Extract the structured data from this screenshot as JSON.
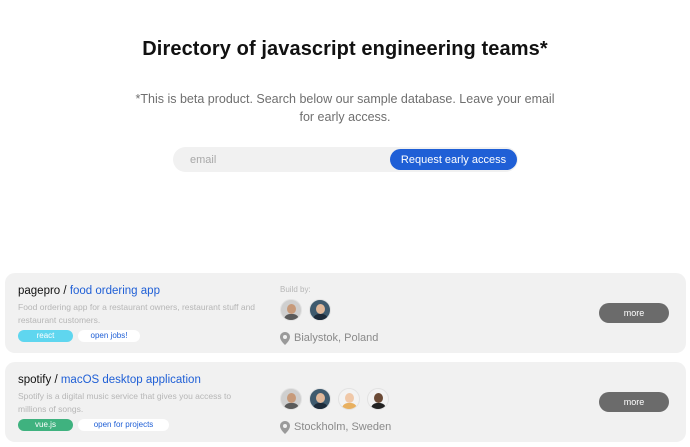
{
  "hero": {
    "title": "Directory of  javascript engineering teams*",
    "subtitle": "*This is beta product. Search below our sample database. Leave your email for early access."
  },
  "signup": {
    "email_placeholder": "email",
    "button_label": "Request early access"
  },
  "colors": {
    "accent": "#1f5fd6",
    "card_bg": "#f1f1f1",
    "more_button": "#6b6b6b"
  },
  "teams": [
    {
      "company": "pagepro",
      "separator": " / ",
      "project": "food ordering app",
      "description": "Food ordering app for a restaurant owners, restaurant stuff and restaurant customers.",
      "tech_tag": "react",
      "tech_color": "#5fd6ef",
      "status_tag": "open jobs!",
      "build_label": "Build by:",
      "location_icon": "map-pin-icon",
      "location": "Bialystok, Poland",
      "more_label": "more",
      "members": [
        {
          "icon": "avatar-man-beard",
          "skin": "#c79a7a",
          "shirt": "#5a5a5a",
          "bg": "#cfcfcf"
        },
        {
          "icon": "avatar-man-suit",
          "skin": "#e0b89a",
          "shirt": "#1d2b3a",
          "bg": "#3e5a6e"
        }
      ]
    },
    {
      "company": "spotify",
      "separator": " / ",
      "project": "macOS desktop application",
      "description": "Spotify is a digital music service that gives you access to millions of songs.",
      "tech_tag": "vue.js",
      "tech_color": "#3fb27f",
      "status_tag": "open for projects",
      "build_label": "",
      "location_icon": "map-pin-icon",
      "location": "Stockholm, Sweden",
      "more_label": "more",
      "members": [
        {
          "icon": "avatar-man-beard",
          "skin": "#c79a7a",
          "shirt": "#5a5a5a",
          "bg": "#cfcfcf"
        },
        {
          "icon": "avatar-man-suit",
          "skin": "#e0b89a",
          "shirt": "#1d2b3a",
          "bg": "#3e5a6e"
        },
        {
          "icon": "avatar-woman-blonde",
          "skin": "#f0c8a8",
          "shirt": "#e8b060",
          "bg": "#f3f3f3"
        },
        {
          "icon": "avatar-man-dark",
          "skin": "#6b4a36",
          "shirt": "#222222",
          "bg": "#f3f3f3"
        }
      ]
    }
  ]
}
